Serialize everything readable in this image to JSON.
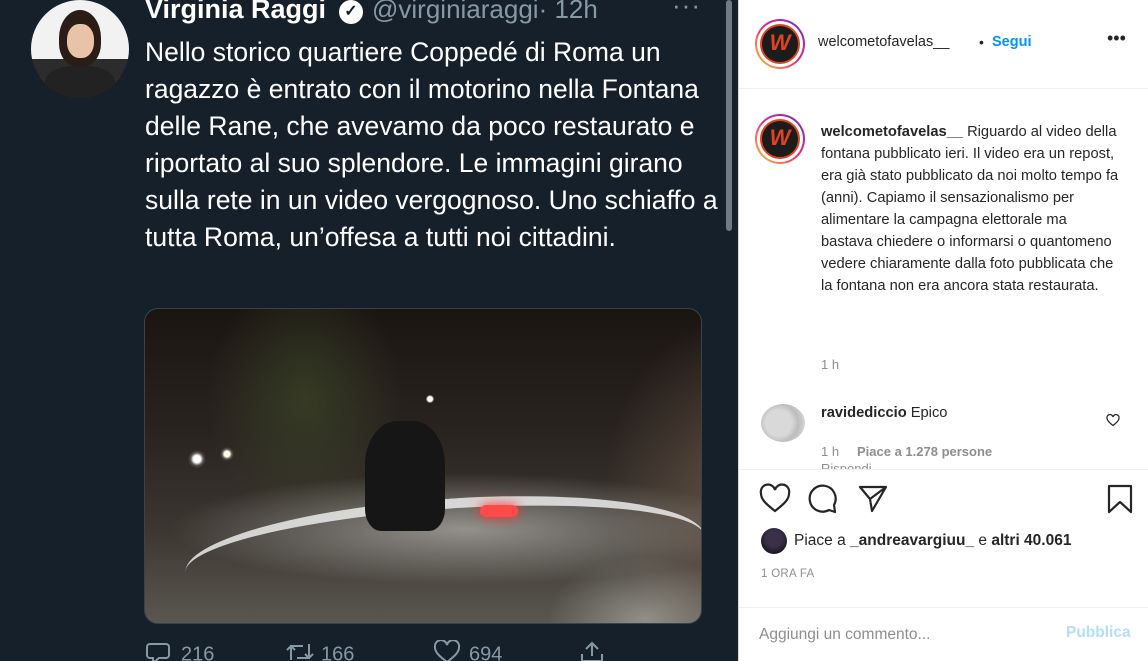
{
  "tweet": {
    "author_name": "Virginia Raggi",
    "handle": "@virginiaraggi",
    "time": "· 12h",
    "more": "···",
    "text": "Nello storico quartiere Coppedé di Roma un ragazzo è entrato con il motorino nella Fontana delle Rane, che avevamo da poco restaurato e riportato al suo splendore. Le immagini girano sulla rete in un video vergognoso. Uno schiaffo a tutta Roma, un’offesa a tutti noi cittadini.",
    "replies": "216",
    "retweets": "166",
    "likes": "694",
    "icons": {
      "reply": "reply-icon",
      "retweet": "retweet-icon",
      "like": "heart-icon",
      "share": "share-icon"
    }
  },
  "instagram": {
    "header": {
      "username": "welcometofavelas__",
      "dot": "•",
      "follow": "Segui",
      "more": "•••"
    },
    "caption": {
      "username": "welcometofavelas__",
      "text": "Riguardo al video della fontana pubblicato ieri. Il video era un repost, era già stato pubblicato da noi molto tempo fa (anni). Capiamo il sensazionalismo per alimentare la campagna elettorale ma bastava chiedere o informarsi o quantomeno vedere chiaramente dalla foto pubblicata che la fontana non era ancora stata restaurata.",
      "time": "1 h"
    },
    "comment": {
      "username": "ravidediccio",
      "text": "Epico",
      "time": "1 h",
      "likes": "Piace a 1.278 persone",
      "reply": "Rispondi"
    },
    "likes": {
      "prefix": "Piace a",
      "user": "_andreavargiuu_",
      "middle": "e",
      "rest": "altri 40.061"
    },
    "timestamp": "1 ORA FA",
    "comment_placeholder": "Aggiungi un commento...",
    "publish": "Pubblica",
    "logo_letter": "W",
    "colors": {
      "accent_blue": "#0095f6",
      "publish_disabled": "#b2dffc",
      "twitter_bg": "#15202b"
    }
  }
}
